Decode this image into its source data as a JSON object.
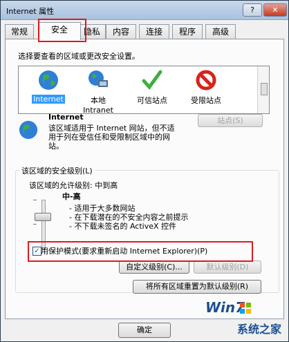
{
  "window": {
    "title": "Internet 属性",
    "help_label": "?",
    "close_label": "✕"
  },
  "tabs": [
    {
      "label": "常规"
    },
    {
      "label": "安全"
    },
    {
      "label": "隐私"
    },
    {
      "label": "内容"
    },
    {
      "label": "连接"
    },
    {
      "label": "程序"
    },
    {
      "label": "高级"
    }
  ],
  "security": {
    "instruction": "选择要查看的区域或更改安全设置。",
    "zones": [
      {
        "label": "Internet",
        "sublabel": "",
        "icon": "globe-icon"
      },
      {
        "label": "本地",
        "sublabel": "Intranet",
        "icon": "intranet-icon"
      },
      {
        "label": "可信站点",
        "sublabel": "",
        "icon": "checkmark-icon"
      },
      {
        "label": "受限站点",
        "sublabel": "",
        "icon": "restricted-icon"
      }
    ],
    "zone_title": "Internet",
    "zone_description": "该区域适用于 Internet 网站，但不适用于列在受信任和受限制区域中的网站。",
    "sites_button": "站点(S)",
    "level_group_label": "该区域的安全级别(L)",
    "allowed_levels": "该区域的允许级别: 中到高",
    "level_name": "中-高",
    "level_bullets": [
      "- 适用于大多数网站",
      "- 在下载潜在的不安全内容之前提示",
      "- 不下载未签名的 ActiveX 控件"
    ],
    "protected_mode_label": "启用保护模式(要求重新启动 Internet Explorer)(P)",
    "protected_mode_checked": true,
    "custom_level_button": "自定义级别(C)...",
    "default_level_button": "默认级别(D)",
    "reset_all_button": "将所有区域重置为默认级别(R)"
  },
  "footer": {
    "ok_button": "确定"
  },
  "watermark": {
    "brand": "Win7",
    "site": "系统之家"
  },
  "colors": {
    "highlight_red": "#e0181e",
    "selection_blue": "#3399ff"
  }
}
